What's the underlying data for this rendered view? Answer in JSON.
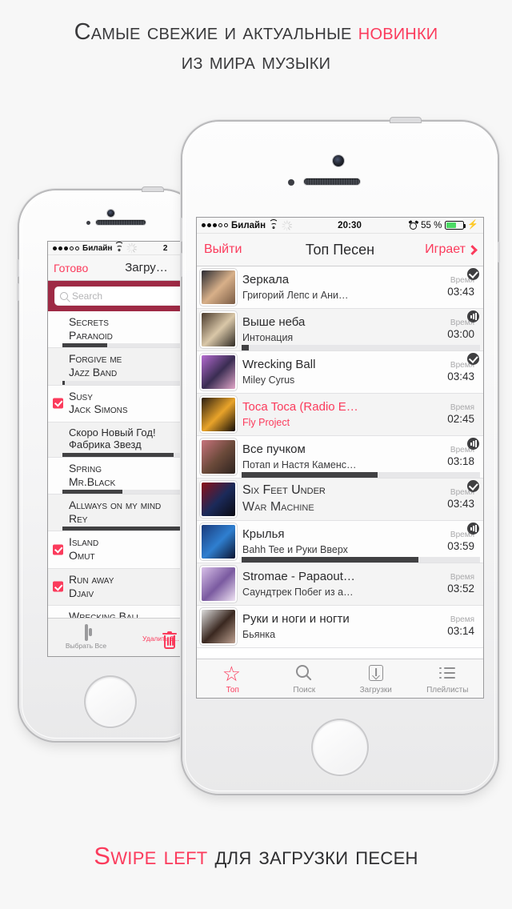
{
  "promo": {
    "headline_line1_plain": "Самые свежие и актуальные ",
    "headline_line1_accent": "новинки",
    "headline_line2": "из мира музыки",
    "footer_accent": "Swipe left",
    "footer_plain": " для загрузки песен",
    "accent_color": "#fb3b5c",
    "background_color": "#f7f7f7"
  },
  "front_phone": {
    "status_bar": {
      "signal_dots_filled": 3,
      "signal_dots_empty": 2,
      "carrier": "Билайн",
      "wifi_icon": "wifi-icon",
      "activity_icon": "activity-spinner-icon",
      "time": "20:30",
      "alarm_icon": "alarm-clock-icon",
      "battery_percent": "55 %",
      "battery_level": 55,
      "charging_icon": "lightning-bolt-icon"
    },
    "nav_bar": {
      "left_button": "Выйти",
      "title": "Топ Песен",
      "right_button": "Играет",
      "right_chevron_icon": "chevron-right-icon"
    },
    "time_label": "Время",
    "songs": [
      {
        "title": "Зеркала",
        "artist": "Григорий Лепс и Ани…",
        "duration": "03:43",
        "badge": "check",
        "progress": null,
        "playing": false,
        "art": [
          "#2b2b33",
          "#d8b089",
          "#7a5c45"
        ]
      },
      {
        "title": "Выше неба",
        "artist": "Интонация",
        "duration": "03:00",
        "badge": "bars",
        "progress": 3,
        "playing": false,
        "art": [
          "#4a3a2c",
          "#d9c7a8",
          "#2f2a23"
        ]
      },
      {
        "title": "Wrecking Ball",
        "artist": "Miley Cyrus",
        "duration": "03:43",
        "badge": "check",
        "progress": null,
        "playing": false,
        "art": [
          "#b46ad0",
          "#3a2d52",
          "#e2a6c8"
        ]
      },
      {
        "title": "Toca Toca (Radio E…",
        "artist": "Fly Project",
        "duration": "02:45",
        "badge": null,
        "progress": null,
        "playing": true,
        "art": [
          "#2a1d10",
          "#e8a32a",
          "#120c06"
        ]
      },
      {
        "title": "Все пучком",
        "artist": "Потап и Настя Каменс…",
        "duration": "03:18",
        "badge": "bars",
        "progress": 57,
        "playing": false,
        "art": [
          "#c7737c",
          "#6b4a3a",
          "#2e2320"
        ]
      },
      {
        "title": "Six Feet Under",
        "artist": "War Machine",
        "duration": "03:43",
        "badge": "check",
        "progress": null,
        "playing": false,
        "art": [
          "#8b0f18",
          "#1b2a5a",
          "#0a0a12"
        ],
        "smallcaps": true
      },
      {
        "title": "Крылья",
        "artist": "Bahh Tee и Руки Вверх",
        "duration": "03:59",
        "badge": "bars",
        "progress": 74,
        "playing": false,
        "art": [
          "#1a3a7a",
          "#2f7fd0",
          "#0b1430"
        ]
      },
      {
        "title": "Stromae - Papaout…",
        "artist": "Саундтрек Побег из а…",
        "duration": "03:52",
        "badge": null,
        "progress": null,
        "playing": false,
        "art": [
          "#d8c0e8",
          "#7a5aa0",
          "#f0e4f4"
        ]
      },
      {
        "title": "Руки и ноги и ногти",
        "artist": "Бьянка",
        "duration": "03:14",
        "badge": null,
        "progress": null,
        "playing": false,
        "art": [
          "#dcdcdc",
          "#3a2820",
          "#bca090"
        ]
      }
    ],
    "tabs": [
      {
        "label": "Топ",
        "icon": "star-icon",
        "active": true
      },
      {
        "label": "Поиск",
        "icon": "search-icon",
        "active": false
      },
      {
        "label": "Загрузки",
        "icon": "download-icon",
        "active": false
      },
      {
        "label": "Плейлисты",
        "icon": "list-icon",
        "active": false
      }
    ]
  },
  "back_phone": {
    "status_bar": {
      "signal_dots_filled": 3,
      "signal_dots_empty": 2,
      "carrier": "Билайн",
      "wifi_icon": "wifi-icon",
      "activity_icon": "activity-spinner-icon",
      "time": "2"
    },
    "nav_bar": {
      "left_button": "Готово",
      "title": "Загру…"
    },
    "search": {
      "placeholder": "Search",
      "value": "",
      "icon": "search-icon",
      "bar_color": "#9e2a45"
    },
    "songs": [
      {
        "title": "Secrets",
        "artist": "Paranoid",
        "checked": false,
        "progress": 33,
        "smallcaps": true
      },
      {
        "title": "Forgive me",
        "artist": "Jazz Band",
        "checked": false,
        "progress": 2,
        "smallcaps": true
      },
      {
        "title": "Susy",
        "artist": "Jack Simons",
        "checked": true,
        "progress": null,
        "smallcaps": true
      },
      {
        "title": "Скоро Новый Год!",
        "artist": "Фабрика Звезд",
        "checked": false,
        "progress": 82,
        "smallcaps": false
      },
      {
        "title": "Spring",
        "artist": "Mr.Black",
        "checked": false,
        "progress": 44,
        "smallcaps": true
      },
      {
        "title": "Allways on my mind",
        "artist": "Rey",
        "checked": false,
        "progress": 100,
        "smallcaps": true
      },
      {
        "title": "Island",
        "artist": "Omut",
        "checked": true,
        "progress": null,
        "smallcaps": true
      },
      {
        "title": "Run away",
        "artist": "Djaiv",
        "checked": true,
        "progress": null,
        "smallcaps": true
      },
      {
        "title": "Wrecking Ball",
        "artist": "",
        "checked": false,
        "progress": null,
        "smallcaps": true
      }
    ],
    "toolbar": [
      {
        "label": "Выбрать Все",
        "icon": "select-all-icon"
      },
      {
        "label": "Удалить В…",
        "icon": "trash-icon"
      }
    ]
  }
}
